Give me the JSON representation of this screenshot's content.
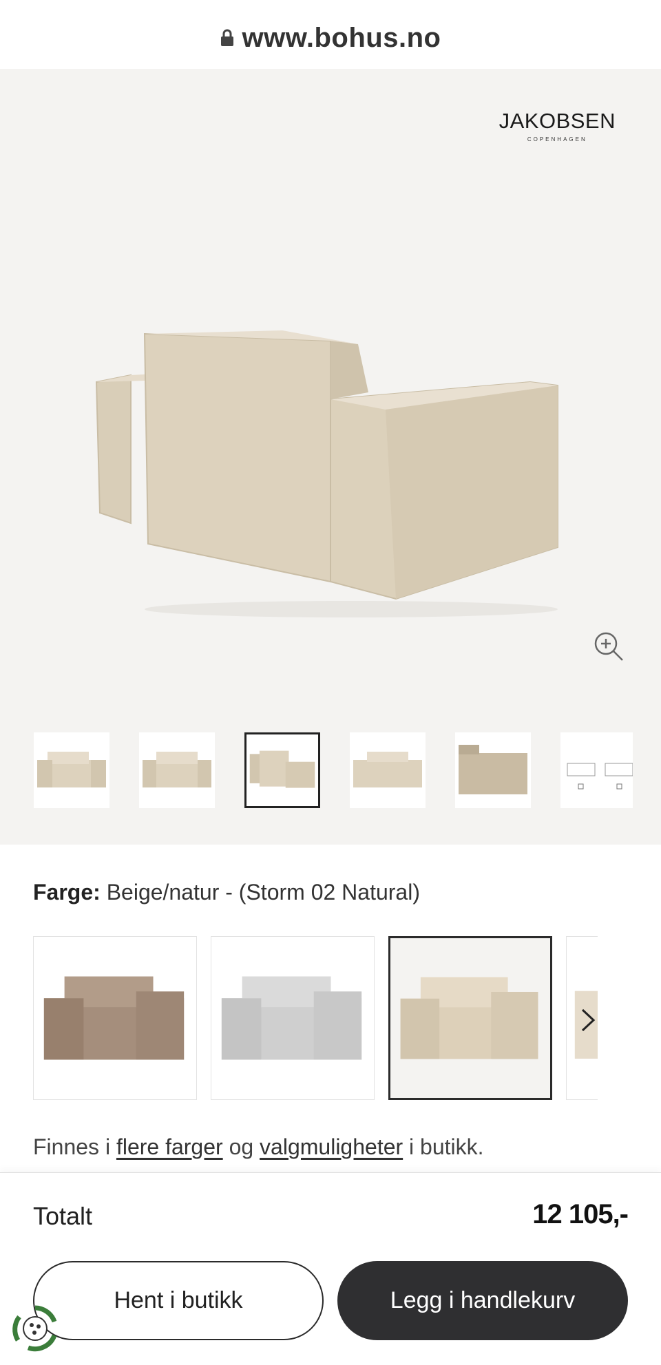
{
  "browser": {
    "url": "www.bohus.no"
  },
  "brand": {
    "name": "JAKOBSEN",
    "sub": "COPENHAGEN"
  },
  "product": {
    "color_label": "Farge:",
    "color_value": "Beige/natur - (Storm 02 Natural)",
    "availability": {
      "prefix": "Finnes i",
      "link1": "flere farger",
      "middle": "og",
      "link2": "valgmuligheter",
      "suffix": "i butikk."
    }
  },
  "gallery": {
    "selected_index": 2,
    "thumb_count": 6
  },
  "swatches": [
    {
      "color": "#a58e7c",
      "selected": false
    },
    {
      "color": "#cfcfcf",
      "selected": false
    },
    {
      "color": "#ddd0b9",
      "selected": true
    }
  ],
  "summary": {
    "total_label": "Totalt",
    "total_price": "12 105,-"
  },
  "actions": {
    "pickup_label": "Hent i butikk",
    "cart_label": "Legg i handlekurv"
  },
  "icons": [
    "lock-icon",
    "zoom-in-icon",
    "chevron-right-icon",
    "eco-badge-icon"
  ],
  "colors": {
    "accent_dark": "#2f2f31",
    "gallery_bg": "#f4f3f1",
    "fabric": "#ddd0b9"
  }
}
